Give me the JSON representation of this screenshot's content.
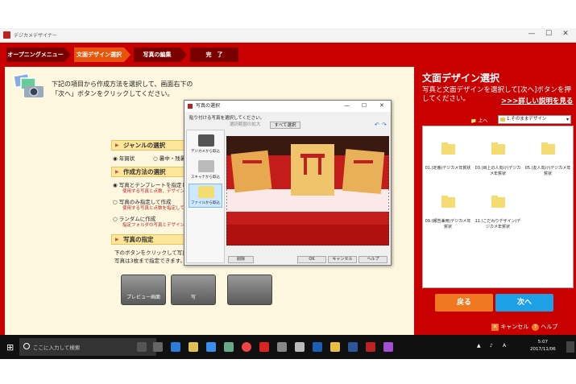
{
  "window": {
    "title": "デジカメデザイナー",
    "controls": [
      "—",
      "☐",
      "✕"
    ]
  },
  "steps": [
    {
      "label": "オープニングメニュー",
      "active": false
    },
    {
      "label": "文面デザイン選択",
      "active": true
    },
    {
      "label": "写真の編集",
      "active": false
    },
    {
      "label": "完　了",
      "active": false
    }
  ],
  "left": {
    "instruction_line1": "下記の項目から作成方法を選択して、画面右下の",
    "instruction_line2": "「次へ」ボタンをクリックしてください。",
    "genre_title": "ジャンルの選択",
    "genre_opt1": "年賀状",
    "genre_opt2": "暑中・残暑",
    "method_title": "作成方法の選択",
    "method1": "写真とテンプレートを指定して",
    "method1_sub": "使用する写真と点数、デザイン",
    "method2": "写真のみ指定して作成",
    "method2_sub": "使用する写真と点数を指定して",
    "method3": "ランダムに作成",
    "method3_sub": "指定フォルダの写真とデザイン",
    "photo_title": "写真の指定",
    "photo_line1": "下のボタンをクリックして写真",
    "photo_line2": "写真は3枚まで指定できます。",
    "preview_button": "プレビュー画面",
    "button2": "写"
  },
  "dialog": {
    "title": "写真の選択",
    "label": "貼り付ける写真を選択してください。",
    "toolbar_range": "選択範囲の拡大",
    "toolbar_select_all": "すべて選択",
    "sources": [
      {
        "label": "デジカメから取込",
        "selected": false
      },
      {
        "label": "スキャナから取込",
        "selected": false
      },
      {
        "label": "ファイルから取込",
        "selected": true
      }
    ],
    "delete_button": "削除",
    "ok_button": "OK",
    "cancel_button": "キャンセル",
    "help_button": "ヘルプ"
  },
  "right": {
    "title": "文面デザイン選択",
    "description": "写真と文面デザインを選択して[次へ]ボタンを押してください。",
    "detail_link": ">>>詳しい説明を見る",
    "up_button": "上へ",
    "folder_select": "1.そのままデザイン",
    "folders": [
      {
        "label": "01.(定番)デジカメ年賀状"
      },
      {
        "label": "03.(目上の人向け)デジカメ年賀状"
      },
      {
        "label": "05.(友人向け)デジカメ年賀状"
      },
      {
        "label": "09.(報告兼用)デジカメ年賀状"
      },
      {
        "label": "11.(こだわりデザイン)デジカメ年賀状"
      }
    ],
    "back_button": "戻る",
    "next_button": "次へ",
    "cancel_label": "キャンセル",
    "help_label": "ヘルプ"
  },
  "taskbar": {
    "search_placeholder": "ここに入力して検索",
    "time": "5:07",
    "date": "2017/11/06",
    "ime": "A"
  },
  "colors": {
    "window_red": "#c80000",
    "active_step": "#e8550a",
    "back_button": "#f07820",
    "next_button": "#1ea0e6"
  }
}
